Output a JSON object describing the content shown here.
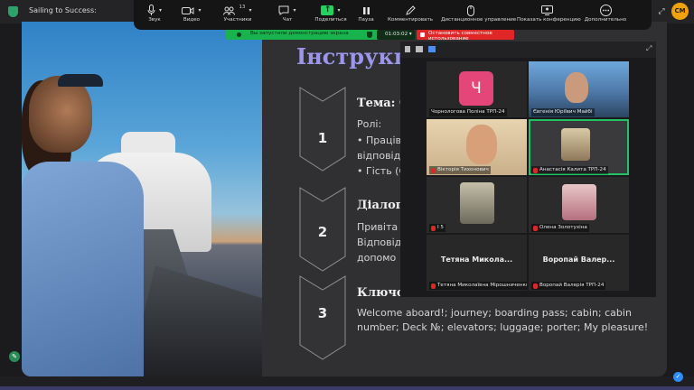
{
  "window": {
    "title": "Sailing to Success:",
    "avatar_initials": "CM"
  },
  "toolbar": {
    "mic": "Звук",
    "video": "Видео",
    "participants": "Участники",
    "participants_count": "13",
    "chat": "Чат",
    "share": "Поделиться",
    "pause": "Пауза",
    "annotate": "Комментировать",
    "remote": "Дистанционное управление",
    "show_conf": "Показать конференцию",
    "more": "Дополнительно"
  },
  "banners": {
    "sharing": "Вы запустили демонстрацию экрана",
    "timer": "01:03:02",
    "stop_collab": "Остановить совместное использование"
  },
  "slide": {
    "heading": "Інструкц",
    "sections": [
      {
        "num": "1",
        "title": "Тема: G",
        "lines": [
          "Ролі:",
          "• Праців",
          "відповід",
          "• Гість (С"
        ]
      },
      {
        "num": "2",
        "title": "Діалог",
        "lines": [
          "Привіта",
          "Відповід",
          "допомо"
        ]
      },
      {
        "num": "3",
        "title": "Ключо",
        "lines": [
          "Welcome aboard!; journey; boarding pass; cabin; cabin",
          "number; Deck №; elevators; luggage; porter; My pleasure!"
        ]
      }
    ]
  },
  "gallery": {
    "tiles": [
      {
        "name": "Чорнологова Поліна ТРП-24",
        "initial": "Ч"
      },
      {
        "name": "Євгенія Юріївич Майбі",
        "initial": ""
      },
      {
        "name": "Вікторія Тихонович",
        "initial": ""
      },
      {
        "name": "Анастасія Калита ТРП-24",
        "initial": ""
      },
      {
        "name": "І 5",
        "initial": ""
      },
      {
        "name": "Олена Золотухіна",
        "initial": ""
      },
      {
        "name": "Тетяна Миколаївна Мірошниченко",
        "big": "Тетяна  Микола..."
      },
      {
        "name": "Воропай Валерія ТРП-24",
        "big": "Воропай  Валер..."
      }
    ]
  },
  "colors": {
    "accent_green": "#19b34e",
    "stop_red": "#e02626",
    "heading_purple": "#9b96ea",
    "avatar_orange": "#f1a20b"
  }
}
